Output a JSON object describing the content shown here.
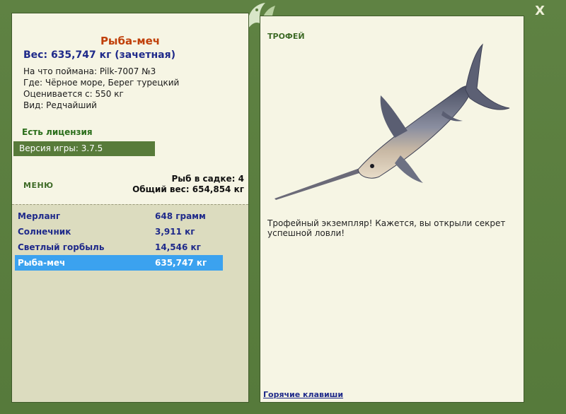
{
  "close_label": "X",
  "catch": {
    "title": "Рыба-меч",
    "weight": "Вес: 635,747 кг (зачетная)",
    "caught_with": "На что поймана: Pilk-7007 №3",
    "location": "Где: Чёрное море, Берег турецкий",
    "valued_from": "Оценивается с: 550 кг",
    "rarity": "Вид: Редчайший"
  },
  "license": "Есть лицензия",
  "version": "Версия игры: 3.7.5",
  "menu_label": "МЕНЮ",
  "stats": {
    "fish_in_keepnet": "Рыб в садке: 4",
    "total_weight": "Общий вес: 654,854 кг"
  },
  "fish_list": [
    {
      "name": "Мерланг",
      "weight": "648 грамм"
    },
    {
      "name": "Солнечник",
      "weight": "3,911 кг"
    },
    {
      "name": "Светлый горбыль",
      "weight": "14,546 кг"
    },
    {
      "name": "Рыба-меч",
      "weight": "635,747 кг"
    }
  ],
  "trophy": {
    "label": "ТРОФЕЙ",
    "text": "Трофейный экземпляр! Кажется, вы открыли секрет успешной ловли!"
  },
  "hotkeys_label": "Горячие клавиши",
  "colors": {
    "frame": "#5a7b3e",
    "panel": "#f6f5e4",
    "selected_row": "#3ba2ef",
    "fish_title": "#c0400a"
  }
}
